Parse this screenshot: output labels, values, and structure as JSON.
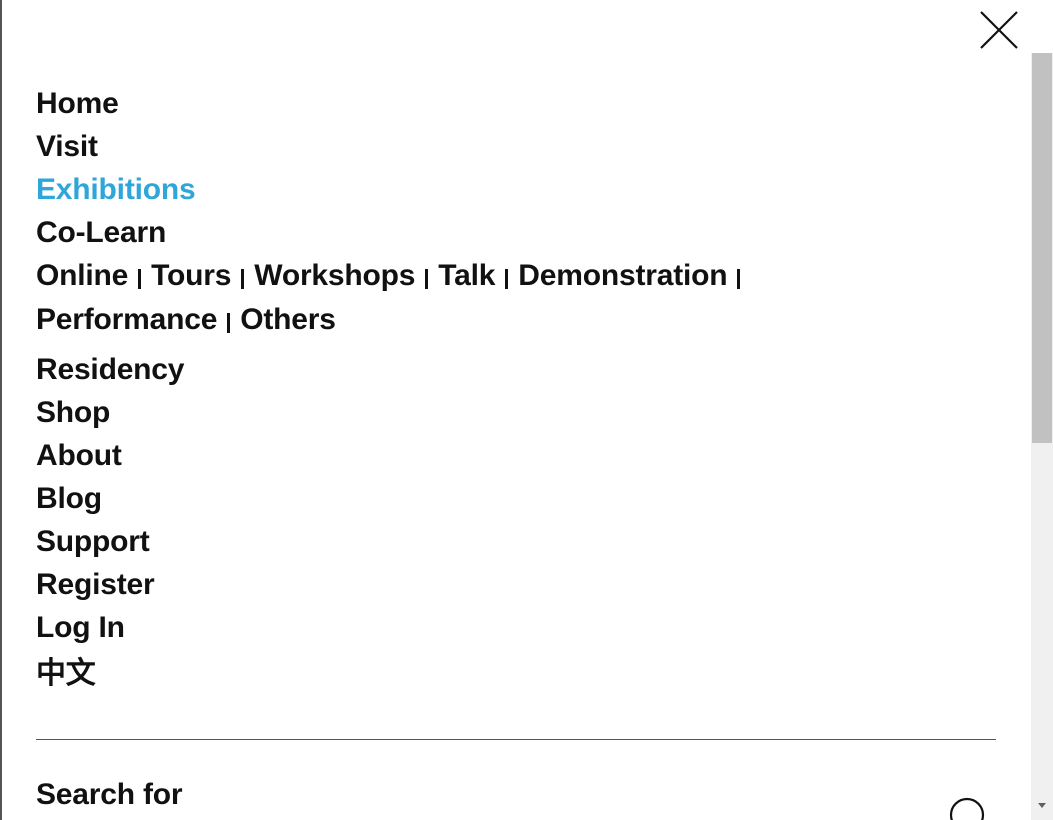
{
  "menu": {
    "close_icon": "close-icon",
    "items_top": [
      {
        "label": "Home",
        "active": false
      },
      {
        "label": "Visit",
        "active": false
      },
      {
        "label": "Exhibitions",
        "active": true
      },
      {
        "label": "Co-Learn",
        "active": false
      }
    ],
    "colearn_sublinks": [
      "Online",
      "Tours",
      "Workshops",
      "Talk",
      "Demonstration",
      "Performance",
      "Others"
    ],
    "items_bottom": [
      {
        "label": "Residency"
      },
      {
        "label": "Shop"
      },
      {
        "label": "About"
      },
      {
        "label": "Blog"
      },
      {
        "label": "Support"
      },
      {
        "label": "Register"
      },
      {
        "label": "Log In"
      },
      {
        "label": "中文"
      }
    ]
  },
  "search": {
    "label": "Search for",
    "icon": "search-icon"
  },
  "colors": {
    "active": "#2fa6d9",
    "text": "#111111",
    "divider": "#555555"
  }
}
